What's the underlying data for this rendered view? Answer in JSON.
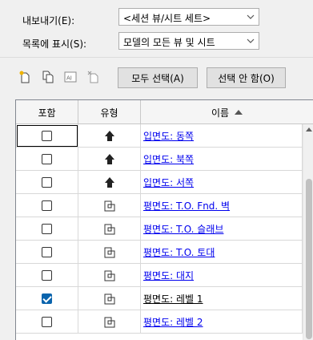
{
  "export": {
    "label": "내보내기(E):",
    "value": "<세션 뷰/시트 세트>"
  },
  "display": {
    "label": "목록에 표시(S):",
    "value": "모델의 모든 뷰 및 시트"
  },
  "toolbar": {
    "icons": [
      "new-set-icon",
      "duplicate-icon",
      "rename-icon",
      "delete-icon"
    ],
    "select_all": "모두 선택(A)",
    "select_none": "선택 안 함(O)"
  },
  "table": {
    "headers": {
      "include": "포함",
      "type": "유형",
      "name": "이름"
    },
    "sort_indicator": "ascending",
    "rows": [
      {
        "checked": false,
        "type": "elevation",
        "name": "입면도: 동쪽"
      },
      {
        "checked": false,
        "type": "elevation",
        "name": "입면도: 북쪽"
      },
      {
        "checked": false,
        "type": "elevation",
        "name": "입면도: 서쪽"
      },
      {
        "checked": false,
        "type": "plan",
        "name": "평면도: T.O. Fnd. 벽"
      },
      {
        "checked": false,
        "type": "plan",
        "name": "평면도: T.O. 슬래브"
      },
      {
        "checked": false,
        "type": "plan",
        "name": "평면도: T.O. 토대"
      },
      {
        "checked": false,
        "type": "plan",
        "name": "평면도: 대지"
      },
      {
        "checked": true,
        "type": "plan",
        "name": "평면도: 레벨 1"
      },
      {
        "checked": false,
        "type": "plan",
        "name": "평면도: 레벨 2"
      }
    ]
  },
  "colors": {
    "link": "#0000ee",
    "checkbox_on": "#0a64ad"
  }
}
